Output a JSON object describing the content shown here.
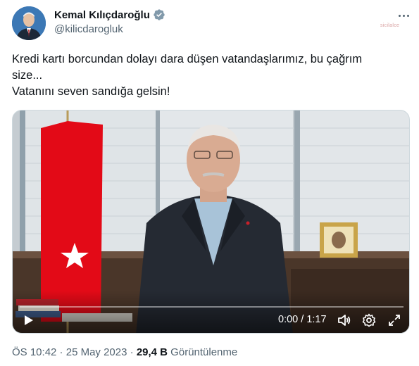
{
  "author": {
    "name": "Kemal Kılıçdaroğlu",
    "handle": "@kilicdarogluk",
    "verified": true
  },
  "watermark": "sicilalce",
  "tweet": {
    "line1": "Kredi kartı borcundan dolayı dara düşen vatandaşlarımız, bu çağrım",
    "line2": "size...",
    "line3": "Vatanını seven sandığa gelsin!"
  },
  "video": {
    "current_time": "0:00",
    "separator": " / ",
    "duration": "1:17",
    "progress": 0.0
  },
  "meta": {
    "time": "ÖS 10:42",
    "dot1": " · ",
    "date": "25 May 2023",
    "dot2": " · ",
    "views": "29,4 B",
    "views_label": " Görüntülenme"
  },
  "colors": {
    "text": "#0f1419",
    "muted": "#536471",
    "verified": "#829aab",
    "flag_red": "#e30a17"
  }
}
